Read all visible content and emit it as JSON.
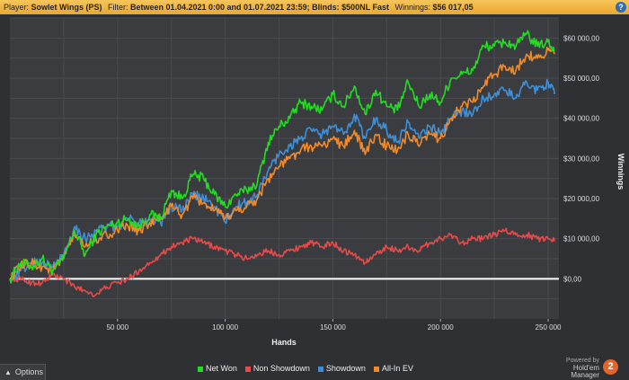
{
  "header": {
    "player_label": "Player:",
    "player": "Sowlet Wings (PS)",
    "filter_label": "Filter:",
    "filter": "Between 01.04.2021 0:00 and 01.07.2021 23:59; Blinds: $500NL Fast",
    "winnings_label": "Winnings:",
    "winnings": "$56 017,05",
    "help_icon": "help-icon"
  },
  "footer": {
    "options_label": "Options",
    "powered_line1": "Powered by",
    "powered_line2": "Hold'em Manager",
    "logo_text": "2"
  },
  "chart_data": {
    "type": "line",
    "xlabel": "Hands",
    "ylabel": "Winnings",
    "xlim": [
      0,
      255000
    ],
    "ylim": [
      -10000,
      65000
    ],
    "x_ticks": [
      50000,
      100000,
      150000,
      200000,
      250000
    ],
    "x_tick_labels": [
      "50 000",
      "100 000",
      "150 000",
      "200 000",
      "250 000"
    ],
    "y_ticks": [
      0,
      10000,
      20000,
      30000,
      40000,
      50000,
      60000
    ],
    "y_tick_labels": [
      "$0,00",
      "$10 000,00",
      "$20 000,00",
      "$30 000,00",
      "$40 000,00",
      "$50 000,00",
      "$60 000,00"
    ],
    "legend_position": "bottom",
    "grid": true,
    "x": [
      0,
      5000,
      10000,
      15000,
      20000,
      25000,
      30000,
      35000,
      40000,
      45000,
      50000,
      55000,
      60000,
      65000,
      70000,
      75000,
      80000,
      85000,
      90000,
      95000,
      100000,
      105000,
      110000,
      115000,
      120000,
      125000,
      130000,
      135000,
      140000,
      145000,
      150000,
      155000,
      160000,
      165000,
      170000,
      175000,
      180000,
      185000,
      190000,
      195000,
      200000,
      205000,
      210000,
      215000,
      220000,
      225000,
      230000,
      235000,
      240000,
      245000,
      250000,
      253000
    ],
    "series": [
      {
        "name": "Net Won",
        "color": "#22dd22",
        "values": [
          0,
          4000,
          3000,
          5000,
          2000,
          5000,
          12000,
          6000,
          11000,
          13000,
          14000,
          15000,
          13000,
          16000,
          15000,
          22000,
          20000,
          26000,
          25000,
          21000,
          18000,
          21000,
          22000,
          24000,
          34000,
          38000,
          40000,
          44000,
          43000,
          42000,
          46000,
          43000,
          48000,
          41000,
          47000,
          43000,
          42000,
          49000,
          43000,
          46000,
          44000,
          50000,
          51000,
          52000,
          58000,
          58000,
          59000,
          58000,
          61000,
          58000,
          59000,
          57000
        ]
      },
      {
        "name": "Non Showdown",
        "color": "#e84a4a",
        "values": [
          0,
          0,
          -1000,
          -1000,
          1000,
          0,
          -2000,
          -3000,
          -4000,
          -2000,
          -1000,
          0,
          2000,
          4000,
          6000,
          8000,
          9000,
          10000,
          9000,
          8000,
          7000,
          6000,
          5000,
          6000,
          7000,
          6000,
          7000,
          8000,
          9000,
          8000,
          9000,
          7000,
          6000,
          4000,
          6000,
          8000,
          7000,
          8000,
          7000,
          9000,
          10000,
          11000,
          9000,
          10000,
          10000,
          11000,
          12000,
          11000,
          11000,
          10000,
          10000,
          10000
        ]
      },
      {
        "name": "Showdown",
        "color": "#3f8fd8",
        "values": [
          0,
          2000,
          4000,
          4000,
          3000,
          6000,
          13000,
          10000,
          12000,
          13000,
          13000,
          15000,
          14000,
          15000,
          14000,
          18000,
          17000,
          21000,
          20000,
          18000,
          14000,
          18000,
          19000,
          21000,
          27000,
          31000,
          33000,
          35000,
          37000,
          36000,
          38000,
          36000,
          41000,
          35000,
          40000,
          37000,
          34000,
          39000,
          35000,
          38000,
          36000,
          40000,
          42000,
          41000,
          45000,
          46000,
          47000,
          45000,
          49000,
          47000,
          49000,
          46000
        ]
      },
      {
        "name": "All-In EV",
        "color": "#f08a2a",
        "values": [
          0,
          3000,
          4000,
          3000,
          2000,
          5000,
          11000,
          8000,
          10000,
          11000,
          12000,
          13000,
          12000,
          14000,
          15000,
          18000,
          16000,
          20000,
          19000,
          17000,
          15000,
          17000,
          18000,
          20000,
          25000,
          28000,
          30000,
          32000,
          33000,
          33000,
          35000,
          33000,
          37000,
          31000,
          36000,
          33000,
          32000,
          36000,
          33000,
          36000,
          35000,
          40000,
          43000,
          44000,
          48000,
          51000,
          53000,
          52000,
          56000,
          55000,
          57000,
          56000
        ]
      }
    ]
  }
}
